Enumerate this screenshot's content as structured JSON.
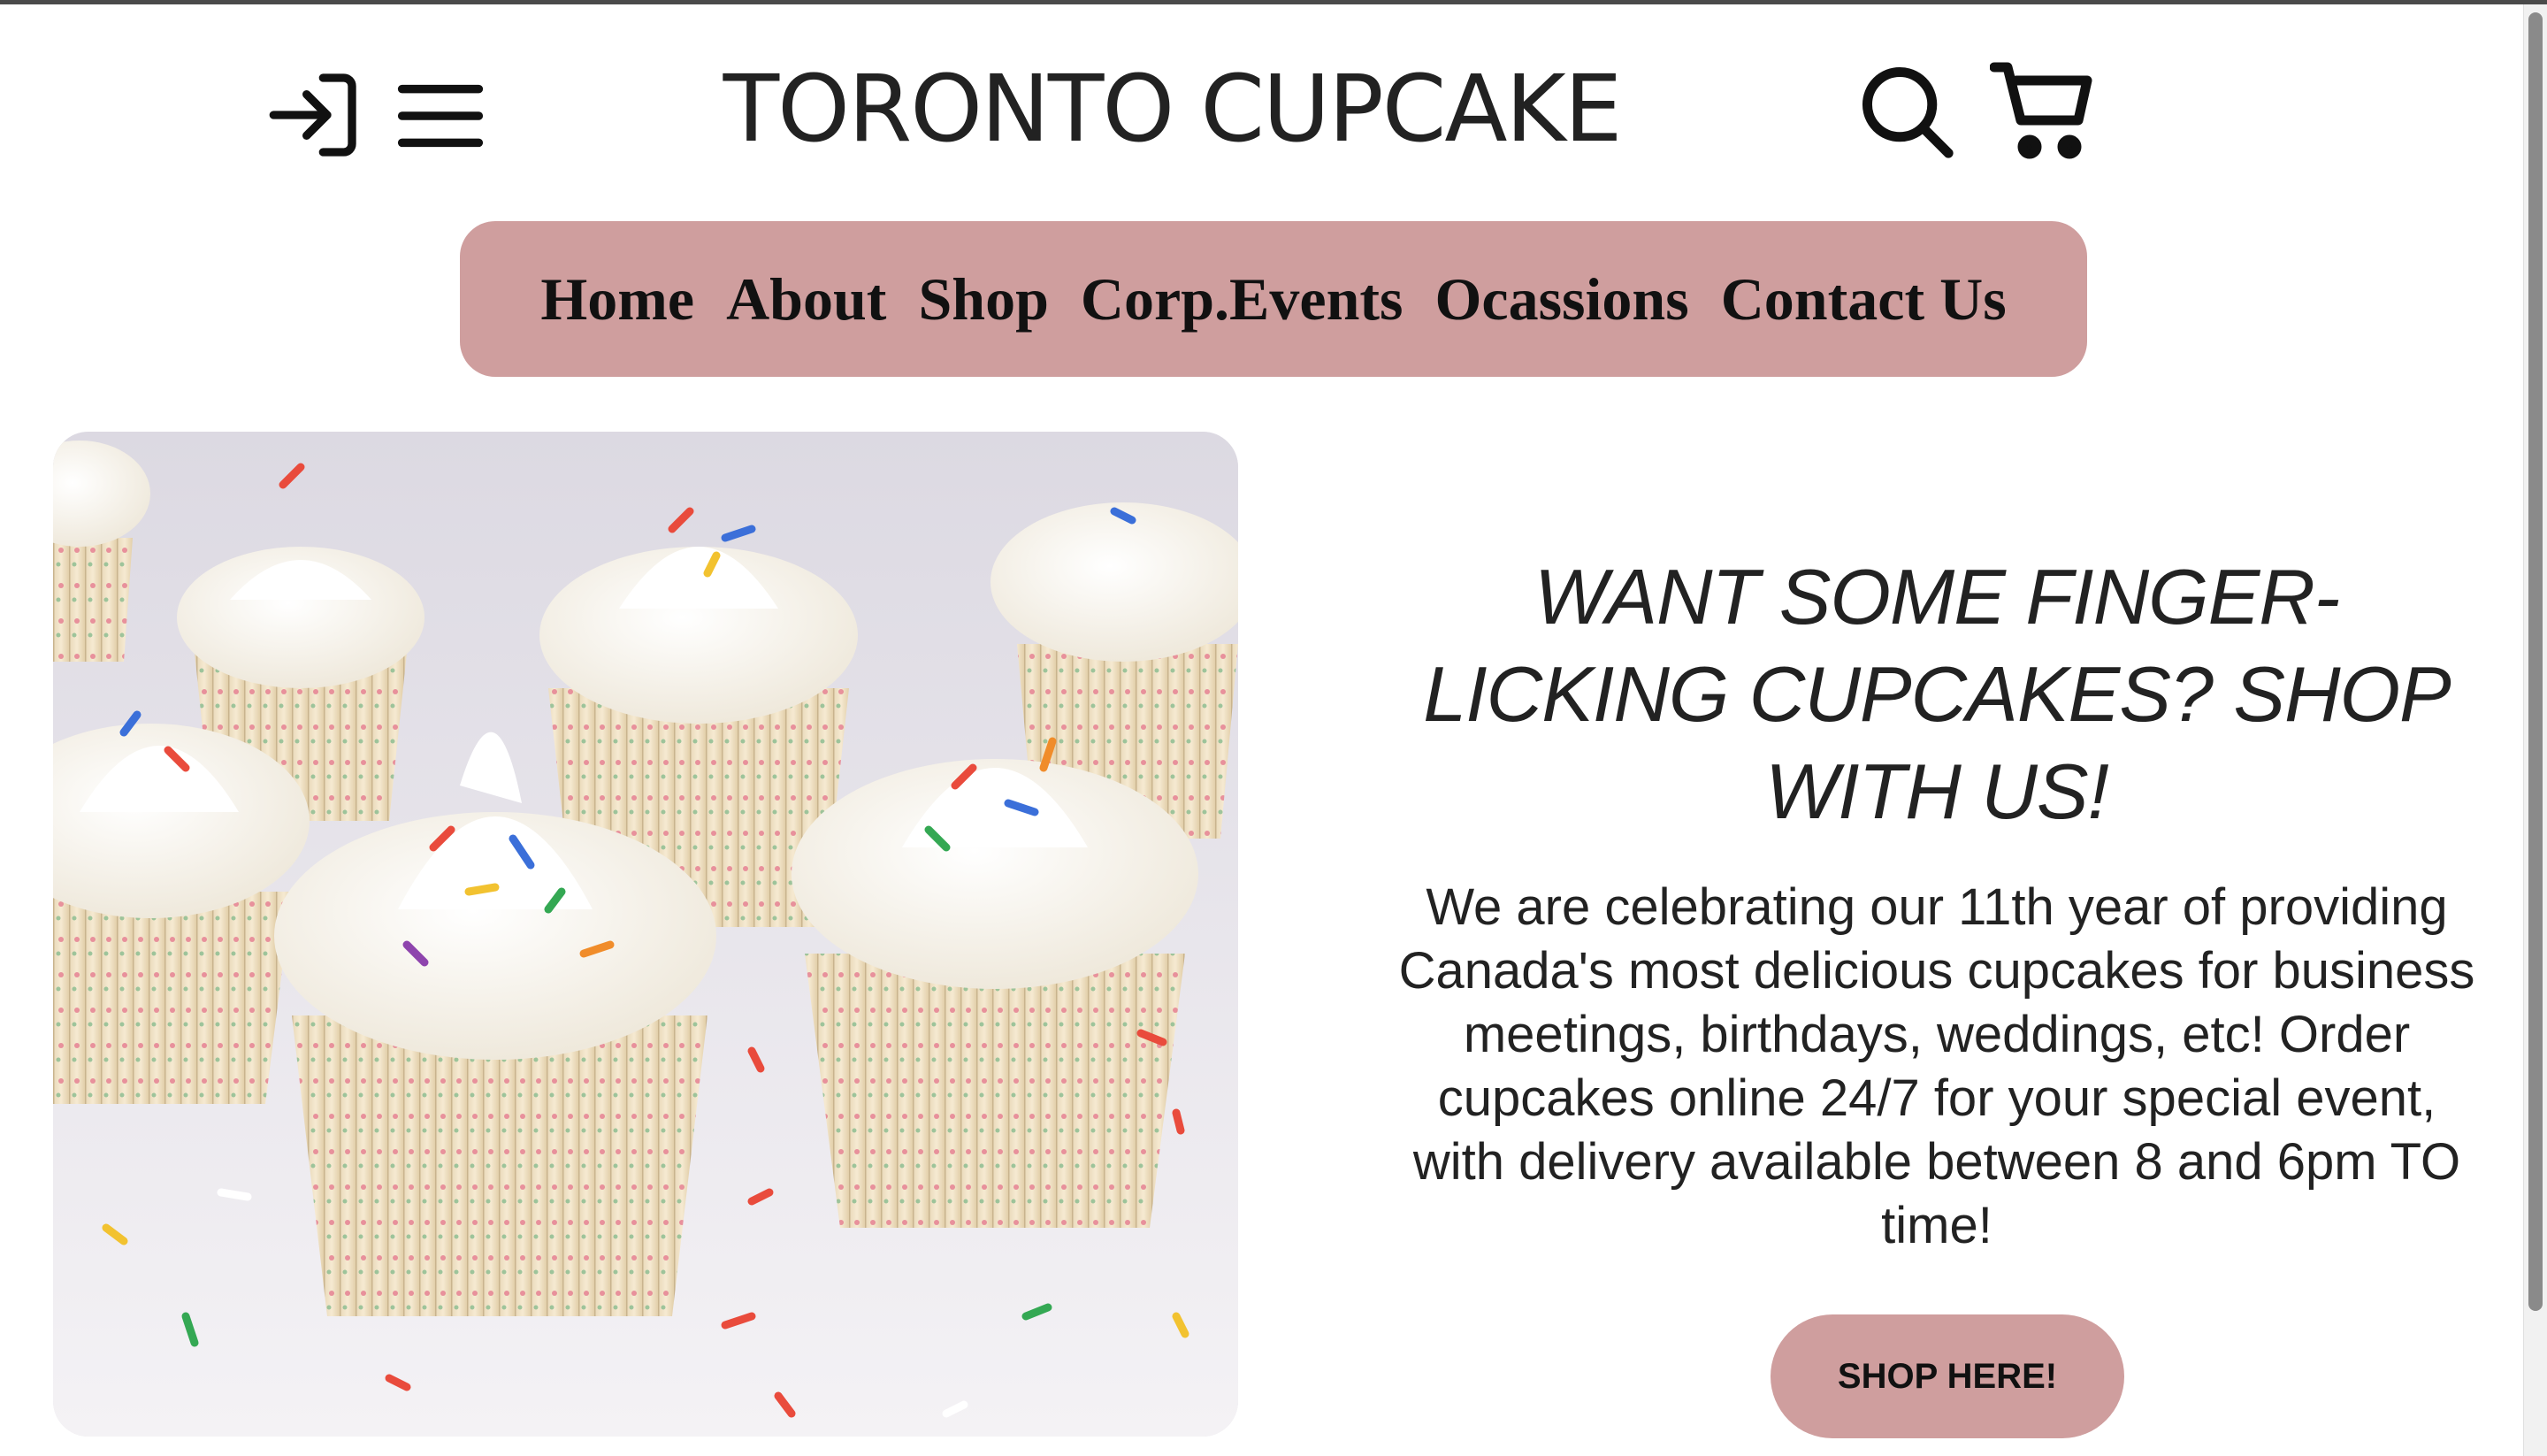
{
  "header": {
    "title": "TORONTO CUPCAKE",
    "icons": {
      "login": "login-icon",
      "menu": "hamburger-menu-icon",
      "search": "search-icon",
      "cart": "cart-icon"
    }
  },
  "nav": {
    "items": [
      {
        "label": "Home"
      },
      {
        "label": "About"
      },
      {
        "label": "Shop"
      },
      {
        "label": "Corp.Events"
      },
      {
        "label": "Ocassions"
      },
      {
        "label": "Contact Us"
      }
    ]
  },
  "hero": {
    "headline": "WANT SOME FINGER-LICKING CUPCAKES? SHOP WITH US!",
    "body": "We are celebrating our 11th year of providing Canada's most delicious cupcakes for business meetings, birthdays, weddings, etc! Order cupcakes online 24/7 for your special event, with delivery available between 8 and 6pm TO time!",
    "button_label": "SHOP HERE!"
  },
  "colors": {
    "accent": "#cf9e9e",
    "text": "#222222"
  }
}
